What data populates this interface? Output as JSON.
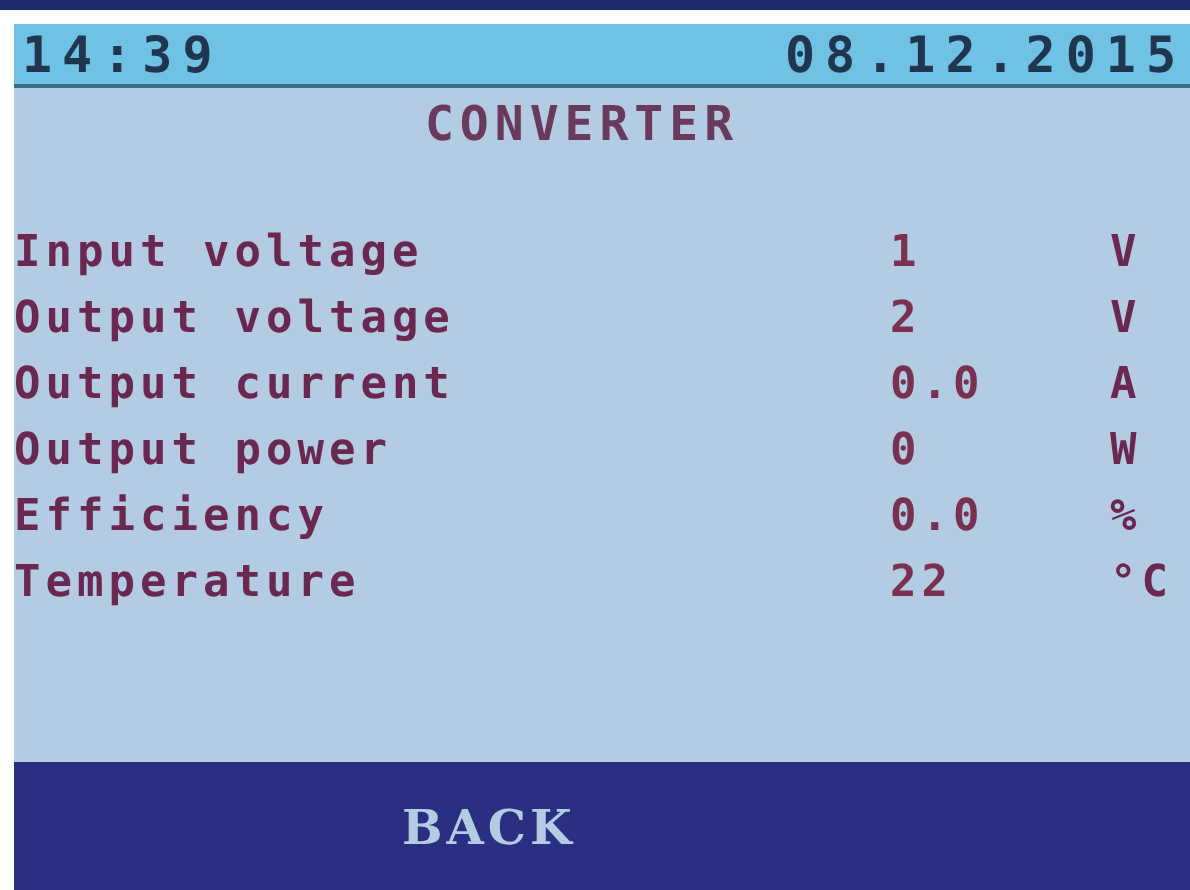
{
  "status_bar": {
    "time": "14:39",
    "date": "08.12.2015"
  },
  "title": "CONVERTER",
  "rows": [
    {
      "label": "Input voltage",
      "value": "1",
      "unit": "V"
    },
    {
      "label": "Output voltage",
      "value": "2",
      "unit": "V"
    },
    {
      "label": "Output current",
      "value": "0.0",
      "unit": "A"
    },
    {
      "label": "Output power",
      "value": "0",
      "unit": "W"
    },
    {
      "label": "Efficiency",
      "value": "0.0",
      "unit": "%"
    },
    {
      "label": "Temperature",
      "value": "22",
      "unit": "°C"
    }
  ],
  "button": "BACK"
}
